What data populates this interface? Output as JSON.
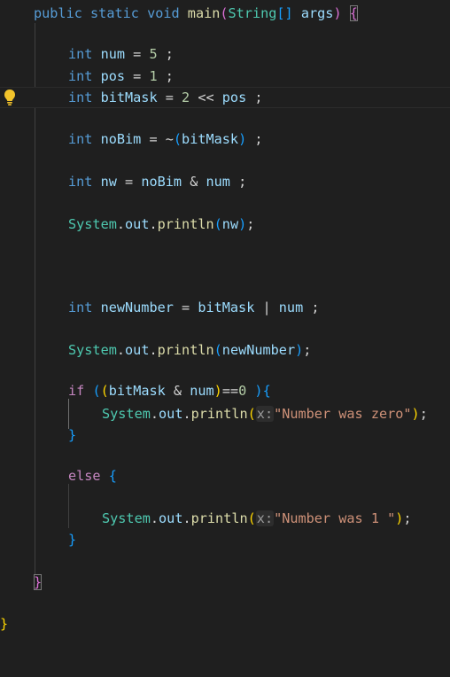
{
  "editor": {
    "lines": {
      "main_decl": {
        "kw_public": "public",
        "kw_static": "static",
        "kw_void": "void",
        "fn_main": "main",
        "paren_open": "(",
        "type_string": "String",
        "arr": "[]",
        "param_args": "args",
        "paren_close": ")",
        "brace_open": "{"
      },
      "num_decl": {
        "kw_int": "int",
        "name": "num",
        "eq": " = ",
        "value": "5",
        "semi": " ;"
      },
      "pos_decl": {
        "kw_int": "int",
        "name": "pos",
        "eq": " = ",
        "value": "1",
        "semi": " ;"
      },
      "bitmask_decl": {
        "kw_int": "int",
        "name": "bitMask",
        "eq": " = ",
        "value": "2",
        "op": " << ",
        "ref": "pos",
        "semi": " ;"
      },
      "nobim_decl": {
        "kw_int": "int",
        "name": "noBim",
        "eq": " = ~",
        "paren_open": "(",
        "ref": "bitMask",
        "paren_close": ")",
        "semi": " ;"
      },
      "nw_decl": {
        "kw_int": "int",
        "name": "nw",
        "eq": " = ",
        "ref1": "noBim",
        "op": " & ",
        "ref2": "num",
        "semi": " ;"
      },
      "print_nw": {
        "cls": "System",
        "dot1": ".",
        "field": "out",
        "dot2": ".",
        "method": "println",
        "paren_open": "(",
        "arg": "nw",
        "paren_close": ")",
        "semi": ";"
      },
      "newnumber_decl": {
        "kw_int": "int",
        "name": "newNumber",
        "eq": " = ",
        "ref1": "bitMask",
        "op": " | ",
        "ref2": "num",
        "semi": " ;"
      },
      "print_newnumber": {
        "cls": "System",
        "dot1": ".",
        "field": "out",
        "dot2": ".",
        "method": "println",
        "paren_open": "(",
        "arg": "newNumber",
        "paren_close": ")",
        "semi": ";"
      },
      "if_stmt": {
        "kw_if": "if",
        "paren_open1": "(",
        "paren_open2": "(",
        "ref1": "bitMask",
        "op": " & ",
        "ref2": "num",
        "paren_close2": ")",
        "cmp": "==",
        "zero": "0",
        "paren_close1": " )",
        "brace_open": "{"
      },
      "print_zero": {
        "cls": "System",
        "dot1": ".",
        "field": "out",
        "dot2": ".",
        "method": "println",
        "paren_open": "(",
        "hint": "x:",
        "string": "\"Number was zero\"",
        "paren_close": ")",
        "semi": ";"
      },
      "if_close": {
        "brace": "}"
      },
      "else_stmt": {
        "kw_else": "else",
        "brace_open": "{"
      },
      "print_one": {
        "cls": "System",
        "dot1": ".",
        "field": "out",
        "dot2": ".",
        "method": "println",
        "paren_open": "(",
        "hint": "x:",
        "string": "\"Number was 1 \"",
        "paren_close": ")",
        "semi": ";"
      },
      "else_close": {
        "brace": "}"
      },
      "main_close": {
        "brace": "}"
      },
      "class_close": {
        "brace": "}"
      }
    }
  }
}
